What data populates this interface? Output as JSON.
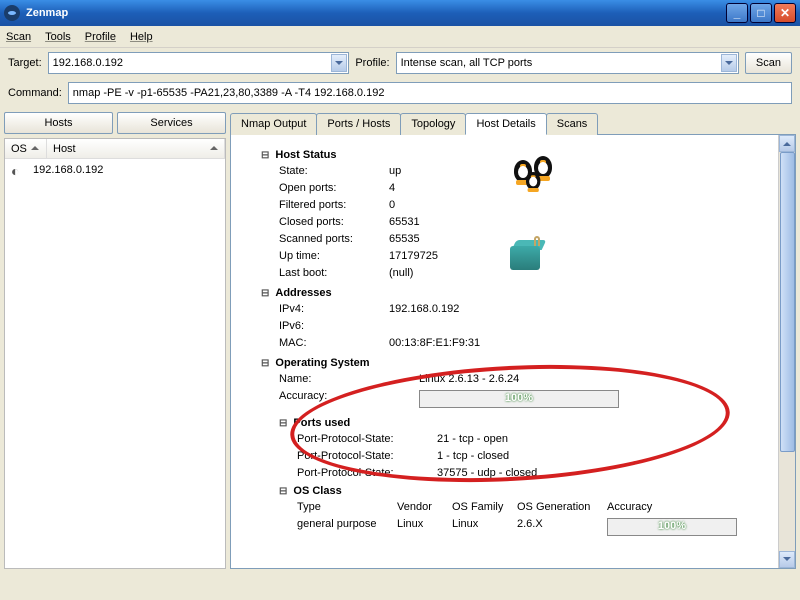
{
  "window": {
    "title": "Zenmap"
  },
  "menu": {
    "scan": "Scan",
    "tools": "Tools",
    "profile": "Profile",
    "help": "Help"
  },
  "toolbar": {
    "target_label": "Target:",
    "target_value": "192.168.0.192",
    "profile_label": "Profile:",
    "profile_value": "Intense scan, all TCP ports",
    "scan_btn": "Scan",
    "command_label": "Command:",
    "command_value": "nmap -PE -v -p1-65535 -PA21,23,80,3389 -A -T4 192.168.0.192"
  },
  "left": {
    "hosts_btn": "Hosts",
    "services_btn": "Services",
    "col_os": "OS",
    "col_host": "Host",
    "rows": [
      {
        "host": "192.168.0.192"
      }
    ]
  },
  "tabs": {
    "nmap_output": "Nmap Output",
    "ports_hosts": "Ports / Hosts",
    "topology": "Topology",
    "host_details": "Host Details",
    "scans": "Scans"
  },
  "details": {
    "host_status_title": "Host Status",
    "state_label": "State:",
    "state": "up",
    "open_label": "Open ports:",
    "open": "4",
    "filtered_label": "Filtered ports:",
    "filtered": "0",
    "closed_label": "Closed ports:",
    "closed": "65531",
    "scanned_label": "Scanned ports:",
    "scanned": "65535",
    "uptime_label": "Up time:",
    "uptime": "17179725",
    "lastboot_label": "Last boot:",
    "lastboot": "(null)",
    "addresses_title": "Addresses",
    "ipv4_label": "IPv4:",
    "ipv4": "192.168.0.192",
    "ipv6_label": "IPv6:",
    "ipv6": "",
    "mac_label": "MAC:",
    "mac": "00:13:8F:E1:F9:31",
    "os_title": "Operating System",
    "os_name_label": "Name:",
    "os_name": "Linux 2.6.13 - 2.6.24",
    "accuracy_label": "Accuracy:",
    "accuracy_pct": "100%",
    "ports_used_title": "Ports used",
    "pps_label": "Port-Protocol-State:",
    "pps1": "21 - tcp - open",
    "pps2": "1 - tcp - closed",
    "pps3": "37575 - udp - closed",
    "os_class_title": "OS Class",
    "osc_type_h": "Type",
    "osc_vendor_h": "Vendor",
    "osc_family_h": "OS Family",
    "osc_gen_h": "OS Generation",
    "osc_acc_h": "Accuracy",
    "osc_type": "general purpose",
    "osc_vendor": "Linux",
    "osc_family": "Linux",
    "osc_gen": "2.6.X",
    "osc_acc_pct": "100%"
  }
}
